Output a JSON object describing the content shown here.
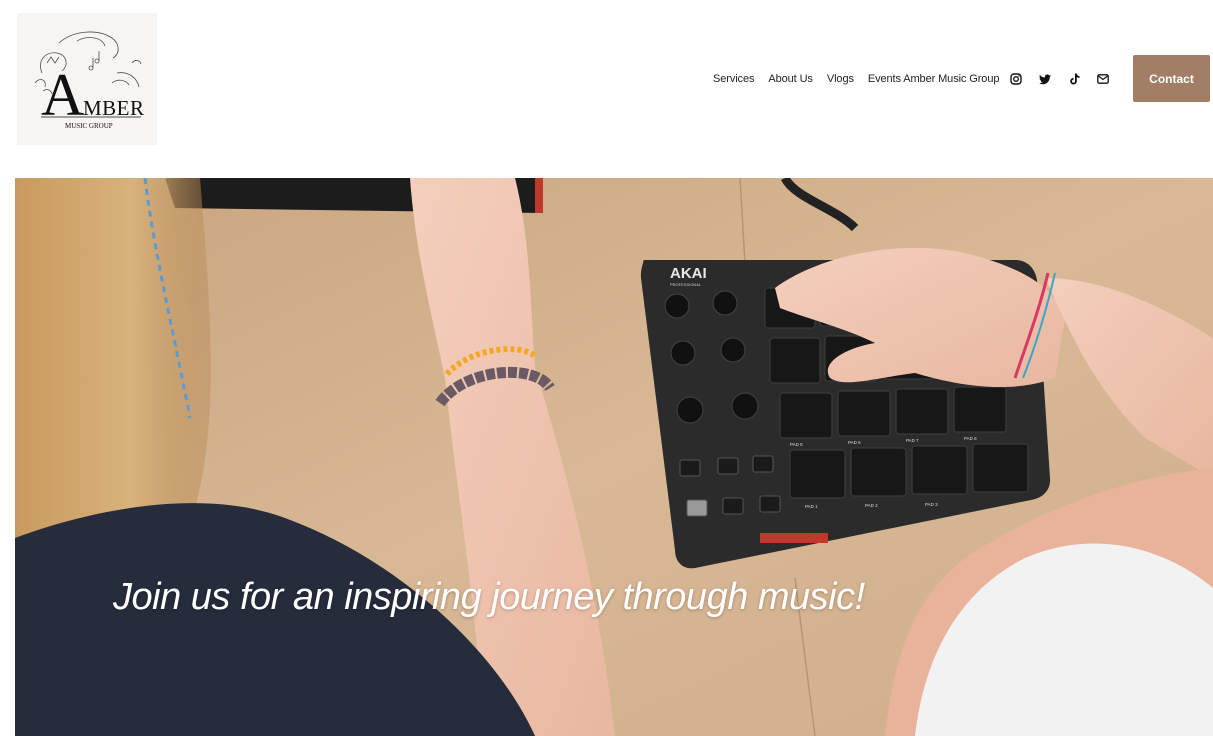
{
  "header": {
    "logo": {
      "alt": "Amber Music Group logo",
      "line1": "MBER",
      "letter": "A",
      "line2": "MUSIC GROUP"
    },
    "nav": [
      {
        "label": "Services"
      },
      {
        "label": "About Us"
      },
      {
        "label": "Vlogs"
      },
      {
        "label": "Events Amber Music Group"
      }
    ],
    "social": [
      {
        "icon": "instagram-icon"
      },
      {
        "icon": "twitter-icon"
      },
      {
        "icon": "tiktok-icon"
      },
      {
        "icon": "email-icon"
      }
    ],
    "contact_label": "Contact"
  },
  "hero": {
    "headline": "Join us for an inspiring journey through music!",
    "device_brand": "AKAI",
    "device_sub": "PROFESSIONAL",
    "pad_labels": [
      "PAD 1",
      "PAD 2",
      "PAD 3",
      "PAD 5",
      "PAD 6",
      "PAD 7",
      "PAD 8"
    ],
    "button_labels": [
      "CTRL BANK",
      "PROG SELECT",
      "PAD BANK",
      "FULL LEVEL",
      "NOTE REPEAT"
    ]
  },
  "colors": {
    "contact_bg": "#a27e66",
    "table": "#d2b08e",
    "device": "#2b2b2b"
  }
}
